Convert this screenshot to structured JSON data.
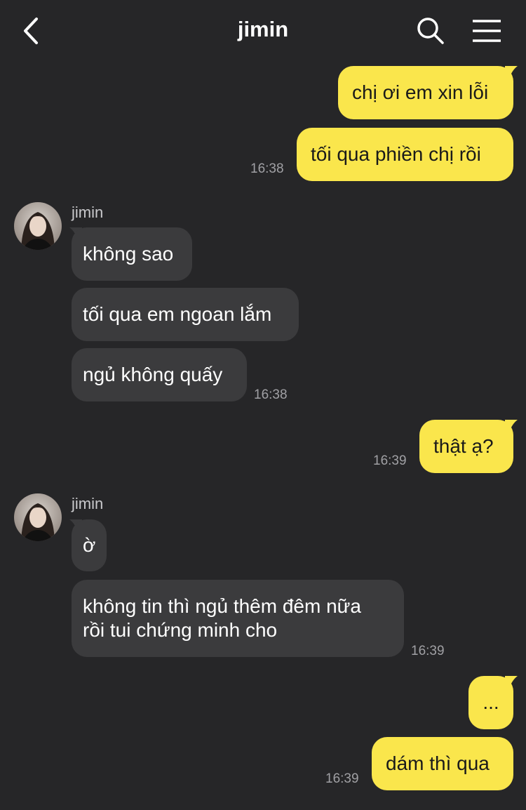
{
  "header": {
    "title": "jimin",
    "back_icon": "chevron-left-icon",
    "search_icon": "search-icon",
    "menu_icon": "hamburger-menu-icon"
  },
  "colors": {
    "background": "#262628",
    "my_bubble": "#fae64c",
    "their_bubble": "#3b3b3d",
    "timestamp": "#a0a0a4"
  },
  "messages": {
    "g1": {
      "m1": "chị ơi em xin lỗi",
      "m2": "tối qua phiền chị rồi",
      "time": "16:38"
    },
    "g2": {
      "sender": "jimin",
      "m1": "không sao",
      "m2": "tối qua em ngoan lắm",
      "m3": "ngủ không quấy",
      "time": "16:38"
    },
    "g3": {
      "m1": "thật ạ?",
      "time": "16:39"
    },
    "g4": {
      "sender": "jimin",
      "m1": "ờ",
      "m2_line1": "không tin thì ngủ thêm đêm nữa",
      "m2_line2": "rồi tui chứng minh cho",
      "time": "16:39"
    },
    "g5": {
      "m1": "...",
      "m2": "dám thì qua",
      "time": "16:39"
    }
  }
}
